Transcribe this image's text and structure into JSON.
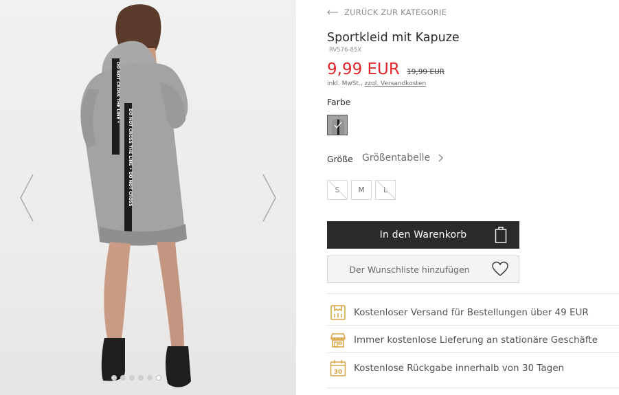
{
  "gallery": {
    "dot_count": 6,
    "active_dot": 5,
    "print_text": "DO NOT CROSS THE LINE"
  },
  "product": {
    "back_label": "ZURÜCK ZUR KATEGORIE",
    "title": "Sportkleid mit Kapuze",
    "sku": "RV576-85X",
    "price": "9,99 EUR",
    "old_price": "19,99 EUR",
    "tax_note": "inkl. MwSt.,",
    "shipping_link": "zzgl. Versandkosten",
    "color_label": "Farbe",
    "size_label": "Größe",
    "size_table_label": "Größentabelle",
    "sizes": [
      {
        "label": "S",
        "available": false
      },
      {
        "label": "M",
        "available": true
      },
      {
        "label": "L",
        "available": false
      }
    ],
    "add_to_cart": "In den Warenkorb",
    "add_to_wishlist": "Der Wunschliste hinzufügen"
  },
  "benefits": [
    {
      "icon": "delivery-box-icon",
      "text": "Kostenloser Versand für Bestellungen über 49 EUR"
    },
    {
      "icon": "storefront-icon",
      "text": "Immer kostenlose Lieferung an stationäre Geschäfte"
    },
    {
      "icon": "calendar-30-icon",
      "text": "Kostenlose Rückgabe innerhalb von 30 Tagen",
      "badge": "30"
    }
  ],
  "colors": {
    "price_red": "#e0272c",
    "button_dark": "#2b2a29",
    "icon_gold": "#d9a441"
  }
}
